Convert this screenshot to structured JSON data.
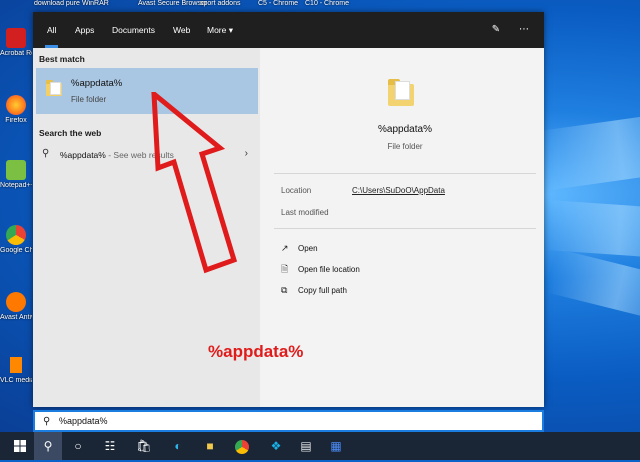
{
  "desktop": {
    "top_labels": [
      "download pure",
      "WinRAR",
      "Avast Secure Browser",
      "sport addons",
      "C5 - Chrome",
      "C10 - Chrome"
    ],
    "icons": [
      {
        "label": "Acrobat Reader DC",
        "icon": "acrobat-icon",
        "color": "#d21f1f"
      },
      {
        "label": "Firefox",
        "icon": "firefox-icon",
        "color": "#ff7a1a"
      },
      {
        "label": "Notepad++",
        "icon": "notepadpp-icon",
        "color": "#7bc043"
      },
      {
        "label": "Google Chrome",
        "icon": "chrome-icon",
        "color": "#34a853"
      },
      {
        "label": "Avast Antivirus Gra",
        "icon": "avast-icon",
        "color": "#ff7800"
      },
      {
        "label": "VLC media",
        "icon": "vlc-icon",
        "color": "#ff8800"
      }
    ]
  },
  "search_panel": {
    "tabs": [
      "All",
      "Apps",
      "Documents",
      "Web",
      "More"
    ],
    "active_tab": "All",
    "header_icons": [
      "feedback-icon",
      "more-options-icon"
    ],
    "best_match_title": "Best match",
    "best_match": {
      "name": "%appdata%",
      "type": "File folder"
    },
    "search_web_title": "Search the web",
    "web_result": {
      "query": "%appdata%",
      "suffix": " - See web results"
    },
    "preview": {
      "name": "%appdata%",
      "type": "File folder",
      "location_label": "Location",
      "location_value": "C:\\Users\\SuDoO\\AppData",
      "modified_label": "Last modified"
    },
    "actions": [
      {
        "label": "Open",
        "icon": "open-icon"
      },
      {
        "label": "Open file location",
        "icon": "file-location-icon"
      },
      {
        "label": "Copy full path",
        "icon": "copy-icon"
      }
    ]
  },
  "annotation": {
    "text": "%appdata%",
    "color": "#e01b1b"
  },
  "search_bar": {
    "value": "%appdata%"
  },
  "taskbar": {
    "items": [
      "windows-start-icon",
      "search-icon",
      "task-view-icon",
      "snap-icon",
      "store-icon",
      "edge-icon",
      "file-explorer-icon",
      "chrome-icon",
      "kodi-icon",
      "notepad-icon",
      "word-icon"
    ]
  },
  "colors": {
    "accent": "#1c7de0",
    "selection": "#a9c7e2"
  }
}
